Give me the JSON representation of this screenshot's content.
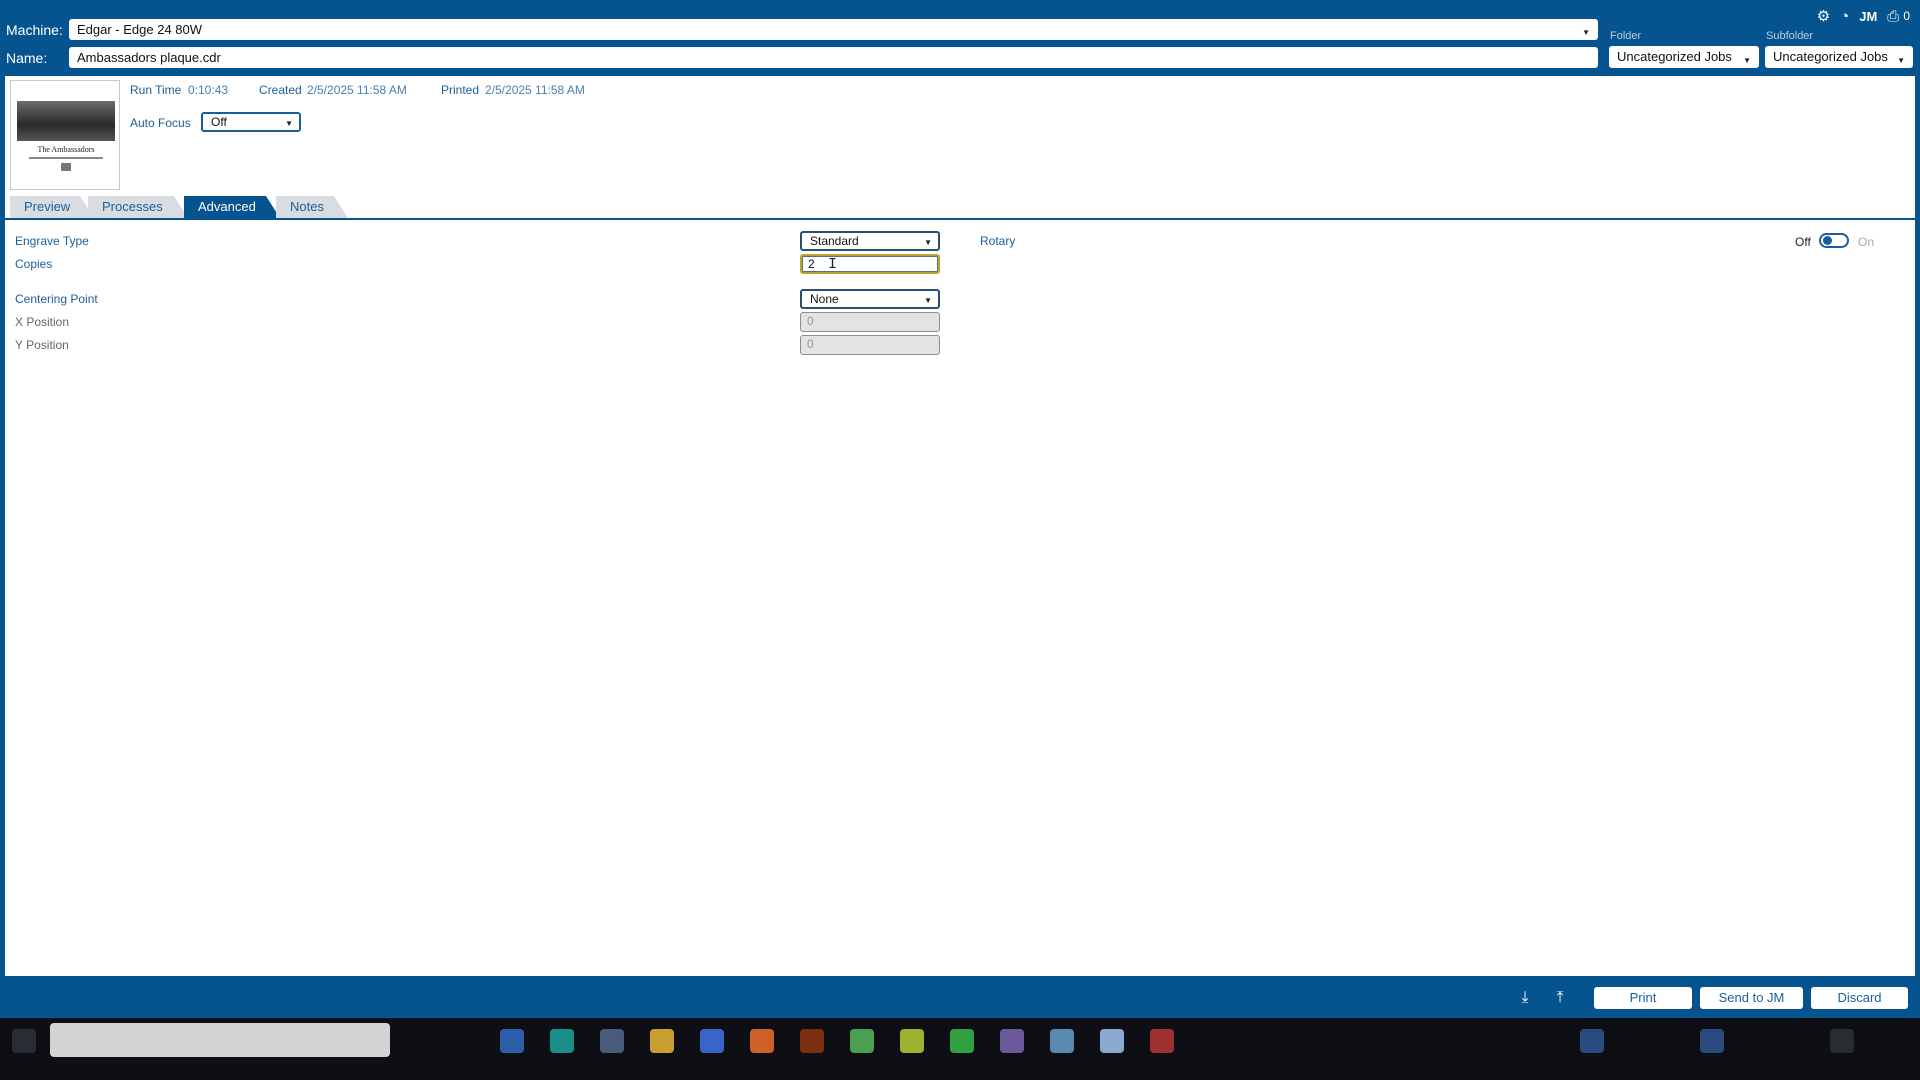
{
  "header": {
    "machine_label": "Machine:",
    "machine_value": "Edgar - Edge 24 80W",
    "name_label": "Name:",
    "name_value": "Ambassadors plaque.cdr",
    "folder_label": "Folder",
    "folder_value": "Uncategorized Jobs",
    "subfolder_label": "Subfolder",
    "subfolder_value": "Uncategorized Jobs",
    "user_initials": "JM",
    "print_count": "0"
  },
  "info": {
    "thumbnail_title": "The Ambassadors",
    "run_time_label": "Run Time",
    "run_time_value": "0:10:43",
    "created_label": "Created",
    "created_value": "2/5/2025 11:58 AM",
    "printed_label": "Printed",
    "printed_value": "2/5/2025 11:58 AM",
    "auto_focus_label": "Auto Focus",
    "auto_focus_value": "Off"
  },
  "tabs": [
    {
      "label": "Preview",
      "active": false
    },
    {
      "label": "Processes",
      "active": false
    },
    {
      "label": "Advanced",
      "active": true
    },
    {
      "label": "Notes",
      "active": false
    }
  ],
  "advanced": {
    "engrave_type_label": "Engrave Type",
    "engrave_type_value": "Standard",
    "copies_label": "Copies",
    "copies_value": "2",
    "centering_point_label": "Centering Point",
    "centering_point_value": "None",
    "x_position_label": "X Position",
    "x_position_value": "0",
    "y_position_label": "Y Position",
    "y_position_value": "0",
    "rotary_label": "Rotary",
    "rotary_off": "Off",
    "rotary_on": "On"
  },
  "footer": {
    "print_label": "Print",
    "send_label": "Send to JM",
    "discard_label": "Discard"
  },
  "colors": {
    "brand_blue": "#05548f",
    "label_blue": "#1a5e9a"
  }
}
